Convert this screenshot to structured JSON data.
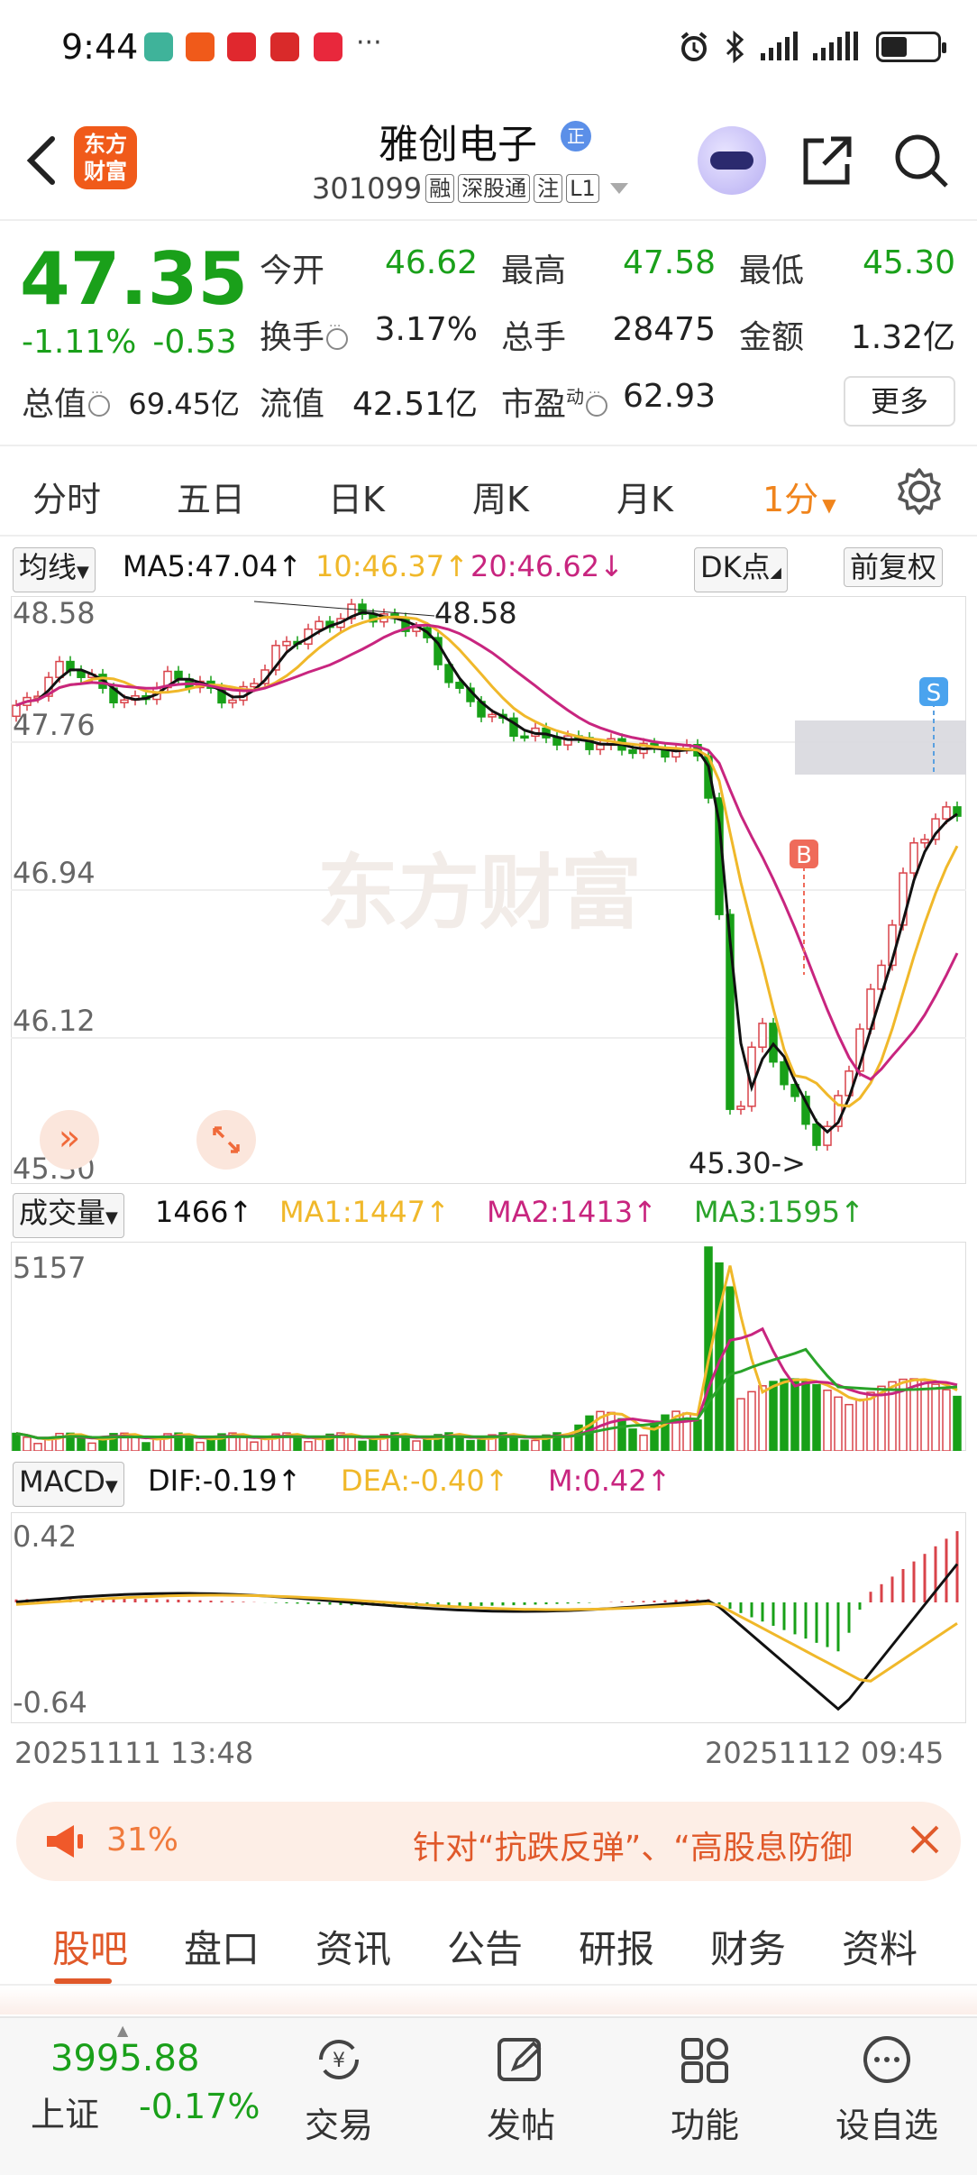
{
  "status_bar": {
    "time": "9:44",
    "more": "···"
  },
  "header": {
    "logo_text_1": "东方",
    "logo_text_2": "财富",
    "stock_name": "雅创电子",
    "stock_badge": "正",
    "stock_code": "301099",
    "tags": [
      "融",
      "深股通",
      "注",
      "L1"
    ]
  },
  "quote": {
    "price": "47.35",
    "change_pct": "-1.11%",
    "change_abs": "-0.53",
    "open_label": "今开",
    "open_value": "46.62",
    "high_label": "最高",
    "high_value": "47.58",
    "low_label": "最低",
    "low_value": "45.30",
    "turnover_label": "换手",
    "turnover_value": "3.17%",
    "volume_label": "总手",
    "volume_value": "28475",
    "amount_label": "金额",
    "amount_value": "1.32亿",
    "mcap_label": "总值",
    "mcap_value": "69.45亿",
    "float_label": "流值",
    "float_value": "42.51亿",
    "pe_label": "市盈",
    "pe_sup": "动",
    "pe_value": "62.93",
    "more_button": "更多"
  },
  "period_tabs": [
    "分时",
    "五日",
    "日K",
    "周K",
    "月K",
    "1分"
  ],
  "period_active_index": 5,
  "chart": {
    "ma_select": "均线",
    "ma5": "MA5:47.04↑",
    "ma10": "10:46.37↑",
    "ma20": "20:46.62↓",
    "dk_button": "DK点",
    "adjust_button": "前复权",
    "y_labels": [
      "48.58",
      "47.76",
      "46.94",
      "46.12",
      "45.30"
    ],
    "high_marker": "48.58",
    "low_marker": "45.30->",
    "watermark": "东方财富",
    "buy_marker": "B",
    "sell_marker": "S",
    "vol_select": "成交量",
    "vol_value": "1466↑",
    "vol_ma1": "MA1:1447↑",
    "vol_ma2": "MA2:1413↑",
    "vol_ma3": "MA3:1595↑",
    "vol_max": "5157",
    "macd_select": "MACD",
    "dif": "DIF:-0.19↑",
    "dea": "DEA:-0.40↑",
    "m": "M:0.42↑",
    "macd_max": "0.42",
    "macd_min": "-0.64",
    "time_start": "20251111 13:48",
    "time_end": "20251112 09:45",
    "colors": {
      "up": "#d9434a",
      "down": "#18a018",
      "ma5": "#111111",
      "ma10": "#f0b82a",
      "ma20": "#c8257f",
      "vol_ma3": "#2aa32a"
    }
  },
  "banner": {
    "percent": "31%",
    "text": "针对“抗跌反弹”、“高股息防御"
  },
  "info_tabs": [
    "股吧",
    "盘口",
    "资讯",
    "公告",
    "研报",
    "财务",
    "资料"
  ],
  "bottom_nav": {
    "index_value": "3995.88",
    "index_name": "上证",
    "index_change": "-0.17%",
    "items": [
      "交易",
      "发帖",
      "功能",
      "设自选"
    ]
  }
}
